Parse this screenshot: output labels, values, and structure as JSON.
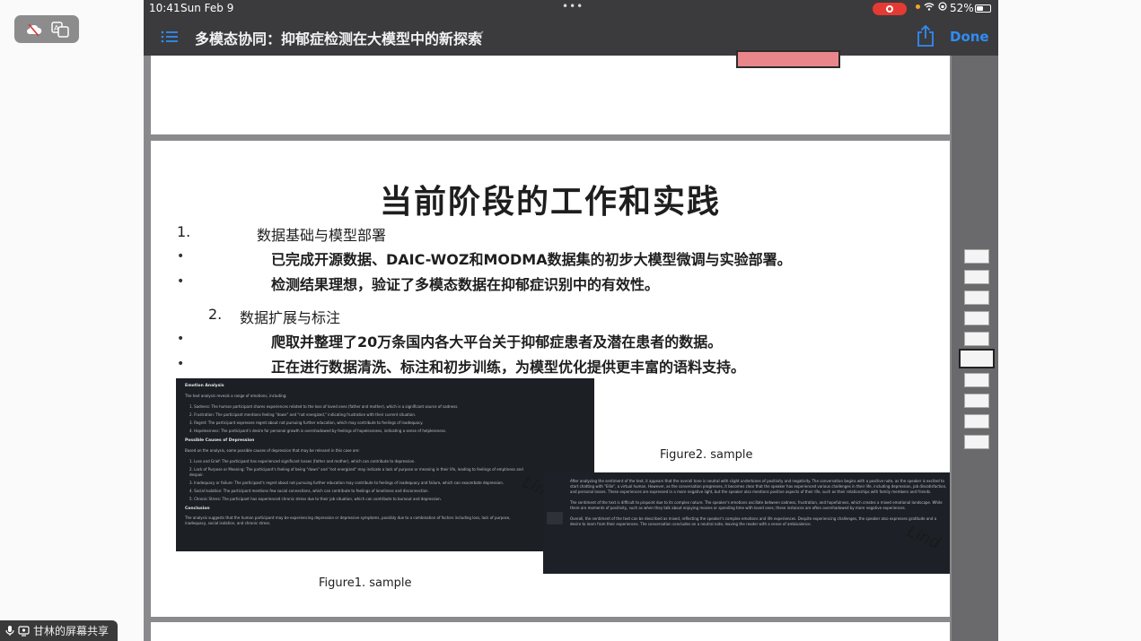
{
  "status": {
    "time": "10:41",
    "date": "Sun Feb 9",
    "battery": "52%",
    "battery_level": 0.52
  },
  "toolbar": {
    "title": "多模态协同：抑郁症检测在大模型中的新探索",
    "done": "Done"
  },
  "slide": {
    "title": "当前阶段的工作和实践",
    "section1": {
      "number": "1.",
      "heading": "数据基础与模型部署"
    },
    "bullets1": [
      "已完成开源数据、DAIC-WOZ和MODMA数据集的初步大模型微调与实验部署。",
      "检测结果理想，验证了多模态数据在抑郁症识别中的有效性。"
    ],
    "section2": {
      "number": "2.",
      "heading": "数据扩展与标注"
    },
    "bullets2": [
      "爬取并整理了20万条国内各大平台关于抑郁症患者及潜在患者的数据。",
      "正在进行数据清洗、标注和初步训练，为模型优化提供更丰富的语料支持。"
    ],
    "bullet_symbol": "•",
    "figure1_caption": "Figure1. sample",
    "figure2_caption": "Figure2. sample",
    "watermark": "Lin",
    "watermark2": "Lind"
  },
  "figure1": {
    "heading": "Emotion Analysis",
    "intro": "The text analysis reveals a range of emotions, including:",
    "emotions": [
      "1. Sadness: The human participant shares experiences related to the loss of loved ones (father and mother), which is a significant source of sadness.",
      "2. Frustration: The participant mentions feeling \"down\" and \"not energized,\" indicating frustration with their current situation.",
      "3. Regret: The participant expresses regret about not pursuing further education, which may contribute to feelings of inadequacy.",
      "4. Hopelessness: The participant's desire for personal growth is overshadowed by feelings of hopelessness, indicating a sense of helplessness."
    ],
    "causes_heading": "Possible Causes of Depression",
    "causes_intro": "Based on the analysis, some possible causes of depression that may be relevant in this case are:",
    "causes": [
      "1. Loss and Grief: The participant has experienced significant losses (father and mother), which can contribute to depression.",
      "2. Lack of Purpose or Meaning: The participant's feeling of being \"down\" and \"not energized\" may indicate a lack of purpose or meaning in their life, leading to feelings of emptiness and despair.",
      "3. Inadequacy or failure: The participant's regret about not pursuing further education may contribute to feelings of inadequacy and failure, which can exacerbate depression.",
      "4. Social Isolation: The participant mentions few social connections, which can contribute to feelings of loneliness and disconnection.",
      "5. Chronic Stress: The participant has experienced chronic stress due to their job situation, which can contribute to burnout and depression."
    ],
    "conclusion_heading": "Conclusion",
    "conclusion": "The analysis suggests that the human participant may be experiencing depression or depressive symptoms, possibly due to a combination of factors including loss, lack of purpose, inadequacy, social isolation, and chronic stress."
  },
  "figure2": {
    "p1": "After analyzing the sentiment of the text, it appears that the overall tone is neutral with slight undertones of positivity and negativity. The conversation begins with a positive note, as the speaker is excited to start chatting with \"Ellie\", a virtual human. However, as the conversation progresses, it becomes clear that the speaker has experienced various challenges in their life, including depression, job dissatisfaction, and personal losses. These experiences are expressed in a more negative light, but the speaker also mentions positive aspects of their life, such as their relationships with family members and friends.",
    "p2": "The sentiment of the text is difficult to pinpoint due to its complex nature. The speaker's emotions oscillate between sadness, frustration, and hopefulness, which creates a mixed emotional landscape. While there are moments of positivity, such as when they talk about enjoying movies or spending time with loved ones, these instances are often overshadowed by more negative experiences.",
    "p3": "Overall, the sentiment of the text can be described as mixed, reflecting the speaker's complex emotions and life experiences. Despite experiencing challenges, the speaker also expresses gratitude and a desire to learn from their experiences. The conversation concludes on a neutral note, leaving the reader with a sense of ambivalence."
  },
  "screen_share": {
    "label": "甘林的屏幕共享"
  }
}
